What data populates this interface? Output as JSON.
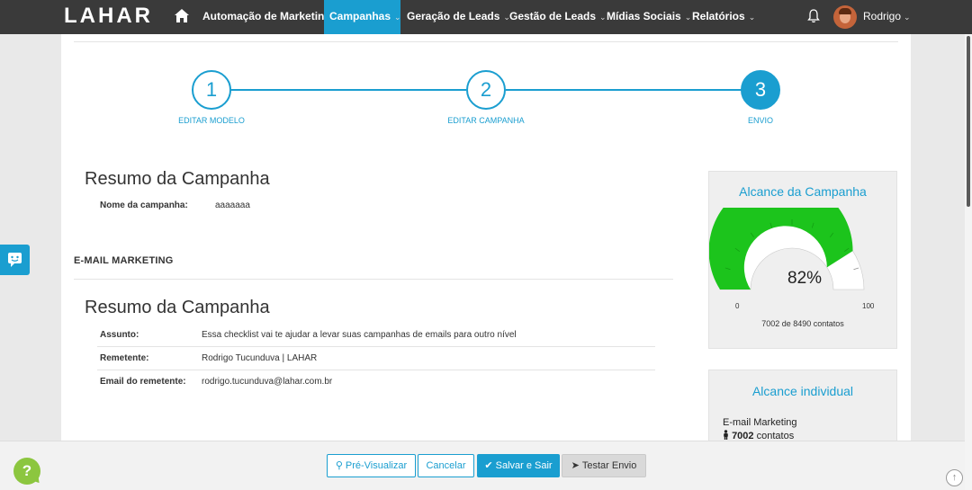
{
  "brand": {
    "logo_text": "LAHAR"
  },
  "nav": {
    "items": [
      {
        "label": "Automação de Marketing",
        "has_dropdown": false
      },
      {
        "label": "Campanhas",
        "has_dropdown": true,
        "active": true
      },
      {
        "label": "Geração de Leads",
        "has_dropdown": true
      },
      {
        "label": "Gestão de Leads",
        "has_dropdown": true
      },
      {
        "label": "Mídias Sociais",
        "has_dropdown": true
      },
      {
        "label": "Relatórios",
        "has_dropdown": true
      }
    ],
    "user_name": "Rodrigo",
    "icons": {
      "home": "home-icon",
      "notifications": "bell-icon",
      "dropdown": "chevron-down-icon"
    }
  },
  "stepper": {
    "steps": [
      {
        "number": "1",
        "label": "EDITAR MODELO",
        "state": "completed"
      },
      {
        "number": "2",
        "label": "EDITAR CAMPANHA",
        "state": "completed"
      },
      {
        "number": "3",
        "label": "ENVIO",
        "state": "current"
      }
    ]
  },
  "summary": {
    "title": "Resumo da Campanha",
    "campaign_name_label": "Nome da campanha:",
    "campaign_name_value": "aaaaaaa"
  },
  "email_section": {
    "header": "E-MAIL MARKETING",
    "title": "Resumo da Campanha",
    "rows": [
      {
        "label": "Assunto:",
        "value": "Essa checklist vai te ajudar a levar suas campanhas de emails para outro nível"
      },
      {
        "label": "Remetente:",
        "value": "Rodrigo Tucunduva | LAHAR"
      },
      {
        "label": "Email do remetente:",
        "value": "rodrigo.tucunduva@lahar.com.br"
      }
    ]
  },
  "reach_card": {
    "title": "Alcance da Campanha",
    "percent_label": "82%",
    "percent_value": 82,
    "min_label": "0",
    "max_label": "100",
    "total_text": "7002 de 8490 contatos",
    "colors": {
      "fill": "#1cc41c",
      "empty": "#ffffff"
    }
  },
  "individual_card": {
    "title": "Alcance individual",
    "channel": "E-mail Marketing",
    "count": "7002",
    "count_suffix": "contatos",
    "icon": "person-icon"
  },
  "footer": {
    "preview_label": "Pré-Visualizar",
    "cancel_label": "Cancelar",
    "save_label": "Salvar e Sair",
    "test_label": "Testar Envio",
    "help_label": "?",
    "icons": {
      "preview": "search-icon",
      "save": "check-icon",
      "test": "send-icon",
      "scroll_top": "arrow-up-icon"
    }
  },
  "colors": {
    "accent": "#1a9ed0",
    "navbar": "#3a3a3a",
    "help": "#8cc63f",
    "gauge_green": "#1cc41c"
  }
}
